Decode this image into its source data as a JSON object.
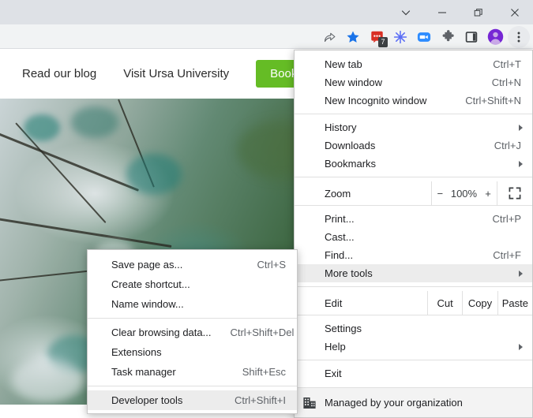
{
  "window": {
    "controls": [
      {
        "name": "tab-search",
        "icon": "chevron-down-icon",
        "tooltip": "Search tabs"
      },
      {
        "name": "minimize",
        "icon": "minimize-icon",
        "tooltip": "Minimize"
      },
      {
        "name": "maximize",
        "icon": "restore-icon",
        "tooltip": "Maximize"
      },
      {
        "name": "close",
        "icon": "close-icon",
        "tooltip": "Close"
      }
    ]
  },
  "toolbar": {
    "icons": [
      {
        "name": "share-icon",
        "label": "Share this page",
        "color": "#5f6368"
      },
      {
        "name": "bookmark-star-icon",
        "label": "Bookmark this tab",
        "color": "#1a73e8"
      },
      {
        "name": "extension-messages-icon",
        "label": "Extension",
        "color": "#d93025",
        "badge": "7"
      },
      {
        "name": "extension-asterisk-icon",
        "label": "Extension",
        "color": "#5b6ef5"
      },
      {
        "name": "zoom-meeting-icon",
        "label": "Zoom",
        "color": "#2d8cff"
      },
      {
        "name": "extensions-puzzle-icon",
        "label": "Extensions",
        "color": "#5f6368"
      },
      {
        "name": "side-panel-icon",
        "label": "Side panel",
        "color": "#3c4043"
      },
      {
        "name": "profile-avatar-icon",
        "label": "Profile",
        "color": "#7627d4"
      },
      {
        "name": "three-dot-menu-icon",
        "label": "Customize and control Google Chrome",
        "color": "#3c4043"
      }
    ]
  },
  "page": {
    "nav_links": [
      {
        "label": "Read our blog"
      },
      {
        "label": "Visit Ursa University"
      }
    ],
    "cta": {
      "label": "Book a",
      "color": "#65bc25"
    },
    "hero": {
      "alt": "Forest canopy photographed from below"
    }
  },
  "main_menu": {
    "groups": [
      {
        "items": [
          {
            "label": "New tab",
            "accel": "Ctrl+T",
            "submenu": false
          },
          {
            "label": "New window",
            "accel": "Ctrl+N",
            "submenu": false
          },
          {
            "label": "New Incognito window",
            "accel": "Ctrl+Shift+N",
            "submenu": false
          }
        ]
      },
      {
        "items": [
          {
            "label": "History",
            "accel": "",
            "submenu": true
          },
          {
            "label": "Downloads",
            "accel": "Ctrl+J",
            "submenu": false
          },
          {
            "label": "Bookmarks",
            "accel": "",
            "submenu": true
          }
        ]
      }
    ],
    "zoom_row": {
      "label": "Zoom",
      "minus": "−",
      "level": "100%",
      "plus": "+",
      "fullscreen_icon": "fullscreen-icon"
    },
    "group3": {
      "items": [
        {
          "label": "Print...",
          "accel": "Ctrl+P",
          "submenu": false
        },
        {
          "label": "Cast...",
          "accel": "",
          "submenu": false
        },
        {
          "label": "Find...",
          "accel": "Ctrl+F",
          "submenu": false
        },
        {
          "label": "More tools",
          "accel": "",
          "submenu": true,
          "highlighted": true
        }
      ]
    },
    "edit_row": {
      "label": "Edit",
      "cut": "Cut",
      "copy": "Copy",
      "paste": "Paste"
    },
    "group4": {
      "items": [
        {
          "label": "Settings",
          "accel": "",
          "submenu": false
        },
        {
          "label": "Help",
          "accel": "",
          "submenu": true
        }
      ]
    },
    "group5": {
      "items": [
        {
          "label": "Exit",
          "accel": "",
          "submenu": false
        }
      ]
    },
    "footer": {
      "label": "Managed by your organization",
      "icon": "organization-building-icon"
    }
  },
  "more_tools_submenu": {
    "groups": [
      {
        "items": [
          {
            "label": "Save page as...",
            "accel": "Ctrl+S"
          },
          {
            "label": "Create shortcut...",
            "accel": ""
          },
          {
            "label": "Name window...",
            "accel": ""
          }
        ]
      },
      {
        "items": [
          {
            "label": "Clear browsing data...",
            "accel": "Ctrl+Shift+Del"
          },
          {
            "label": "Extensions",
            "accel": ""
          },
          {
            "label": "Task manager",
            "accel": "Shift+Esc"
          }
        ]
      },
      {
        "items": [
          {
            "label": "Developer tools",
            "accel": "Ctrl+Shift+I",
            "highlighted": true
          }
        ]
      }
    ]
  }
}
